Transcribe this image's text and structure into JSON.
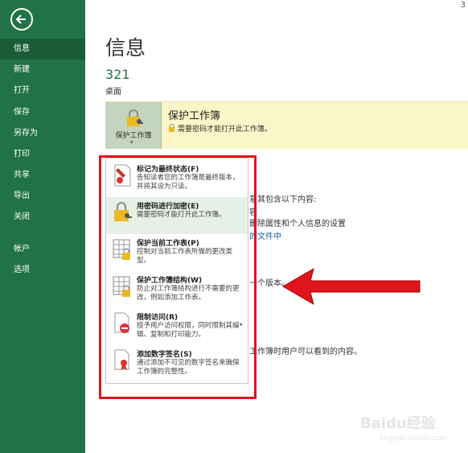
{
  "page_number": "3",
  "sidebar": {
    "items": [
      {
        "label": "信息",
        "active": true
      },
      {
        "label": "新建"
      },
      {
        "label": "打开"
      },
      {
        "label": "保存"
      },
      {
        "label": "另存为"
      },
      {
        "label": "打印"
      },
      {
        "label": "共享"
      },
      {
        "label": "导出"
      },
      {
        "label": "关闭"
      },
      {
        "label": "帐户"
      },
      {
        "label": "选项"
      }
    ]
  },
  "main": {
    "title": "信息",
    "doc_name": "321",
    "doc_location": "桌面",
    "protect": {
      "button_label": "保护工作簿",
      "title": "保护工作簿",
      "description": "需要密码才能打开此工作簿。"
    },
    "partial_text": {
      "t1": "意其包含以下内容:",
      "t2": "容",
      "t3": "删除属性和个人信息的设置",
      "t4": "的文件中",
      "t5": "一个版本。",
      "t6": "工作簿时用户可以看到的内容。"
    }
  },
  "menu": {
    "items": [
      {
        "title": "标记为最终状态(F)",
        "desc": "告知读者您的工作簿是最终版本，并将其设为只读。",
        "icon": "ribbon-mark-icon"
      },
      {
        "title": "用密码进行加密(E)",
        "desc": "需要密码才能打开此工作簿。",
        "icon": "lock-key-icon"
      },
      {
        "title": "保护当前工作表(P)",
        "desc": "控制对当前工作表所做的更改类型。",
        "icon": "sheet-lock-icon"
      },
      {
        "title": "保护工作簿结构(W)",
        "desc": "防止对工作簿结构进行不需要的更改，例如添加工作表。",
        "icon": "workbook-structure-icon"
      },
      {
        "title": "限制访问(R)",
        "desc": "授予用户访问权限，同时限制其编辑、复制和打印能力。",
        "icon": "restrict-access-icon"
      },
      {
        "title": "添加数字签名(S)",
        "desc": "通过添加不可见的数字签名来确保工作簿的完整性。",
        "icon": "signature-icon"
      }
    ]
  },
  "watermark": {
    "logo": "Baidu经验",
    "url": "jingyan.baidu.com"
  },
  "colors": {
    "sidebar": "#217346",
    "accent": "#217346",
    "highlight_frame": "#e0141c",
    "panel": "#faf6c8"
  }
}
